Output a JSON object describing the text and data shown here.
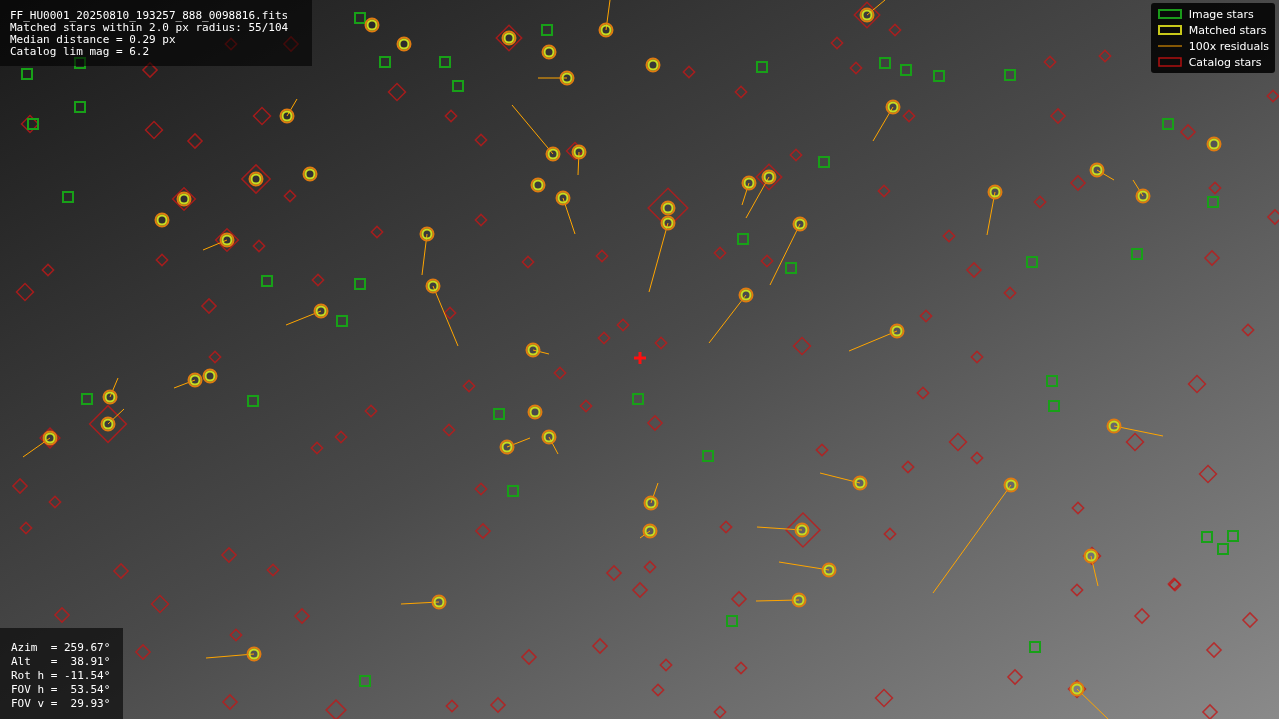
{
  "header_lines": [
    "FF_HU0001_20250810_193257_888_0098816.fits",
    "Matched stars within 2.0 px radius: 55/104",
    "Median distance = 0.29 px",
    "Catalog lim mag = 6.2"
  ],
  "legend": [
    {
      "label": "Image stars"
    },
    {
      "kind": "matched",
      "label": "Matched stars"
    },
    {
      "kind": "residual",
      "label": "100x residuals"
    },
    {
      "kind": "catalog",
      "label": "Catalog stars"
    }
  ],
  "pointing_lines": [
    "Azim  = 259.67°",
    "Alt   =  38.91°",
    "Rot h = -11.54°",
    "FOV h =  53.54°",
    "FOV v =  29.93°"
  ]
}
